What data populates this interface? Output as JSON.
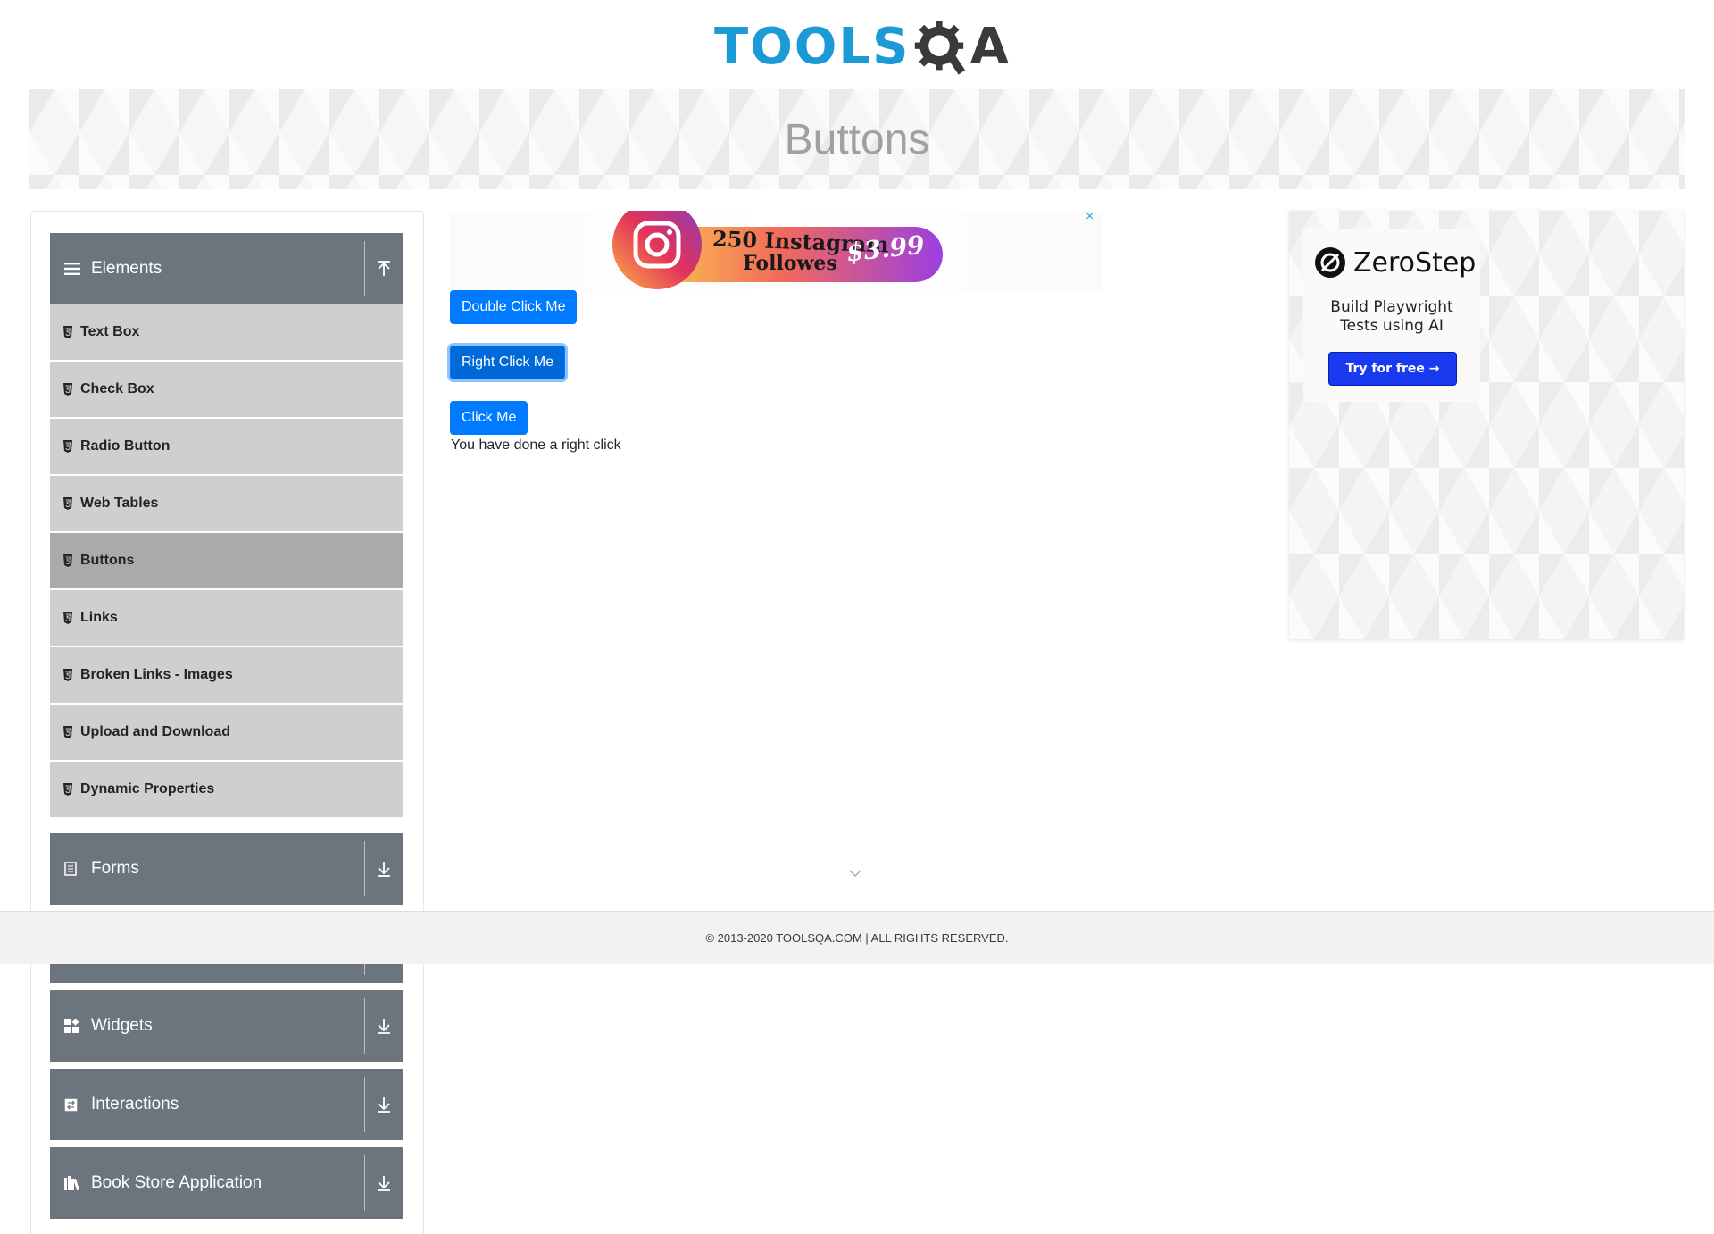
{
  "header": {
    "logo_text_left": "TOOLS",
    "logo_text_right": "A"
  },
  "banner": {
    "title": "Buttons"
  },
  "sidebar": {
    "elements": {
      "label": "Elements",
      "icon": "hamburger-icon"
    },
    "items": [
      {
        "label": "Text Box"
      },
      {
        "label": "Check Box"
      },
      {
        "label": "Radio Button"
      },
      {
        "label": "Web Tables"
      },
      {
        "label": "Buttons",
        "active": true
      },
      {
        "label": "Links"
      },
      {
        "label": "Broken Links - Images"
      },
      {
        "label": "Upload and Download"
      },
      {
        "label": "Dynamic Properties"
      }
    ],
    "groups": [
      {
        "label": "Forms",
        "icon": "document-icon"
      },
      {
        "label": "Widgets",
        "icon": "widgets-icon"
      },
      {
        "label": "Interactions",
        "icon": "interactions-icon"
      },
      {
        "label": "Book Store Application",
        "icon": "books-icon"
      }
    ]
  },
  "ad_top": {
    "line1": "250 Instagram",
    "line2": "Followes",
    "price": "$3.99",
    "close": "×"
  },
  "main": {
    "double_click_label": "Double Click Me",
    "right_click_label": "Right Click Me",
    "click_label": "Click Me",
    "result_message": "You have done a right click"
  },
  "side_ad": {
    "brand": "ZeroStep",
    "tagline_line1": "Build Playwright",
    "tagline_line2": "Tests using AI",
    "cta": "Try for free →"
  },
  "footer": {
    "text": "© 2013-2020 TOOLSQA.COM | ALL RIGHTS RESERVED."
  },
  "colors": {
    "primary": "#007bff",
    "sidebar_header": "#6c757d",
    "menu_item": "#cfcfcf",
    "menu_active": "#aaaaaa",
    "logo_blue": "#1c9ad6"
  }
}
